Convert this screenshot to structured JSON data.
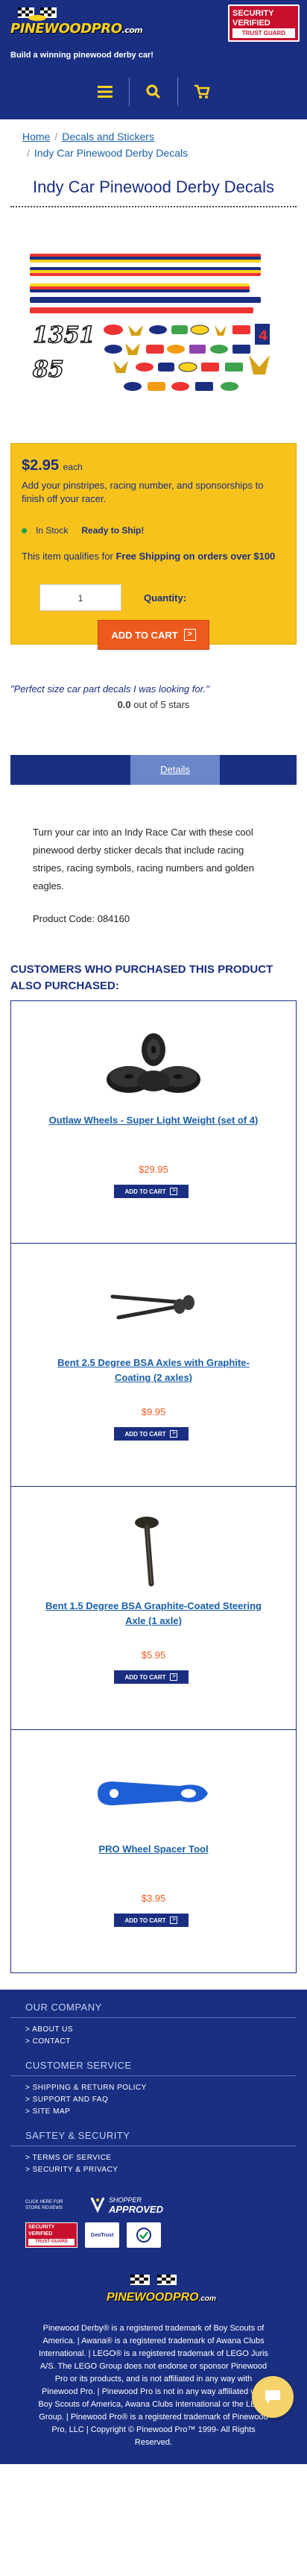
{
  "header": {
    "logo_text": "PINEWOODPRO",
    "logo_suffix": ".com",
    "tagline": "Build a winning pinewood derby car!",
    "security_badge": {
      "line1": "SECURITY",
      "line2": "VERIFIED",
      "line3": "TRUST GUARD"
    },
    "nav_icons": [
      "menu-icon",
      "search-icon",
      "cart-icon"
    ]
  },
  "breadcrumb": {
    "home": "Home",
    "separator": "/",
    "category": "Decals and Stickers",
    "current": "Indy Car Pinewood Derby Decals"
  },
  "product": {
    "title": "Indy Car Pinewood Derby Decals",
    "price": "$2.95",
    "price_unit": "each",
    "price_desc": "Add your pinstripes, racing number, and sponsorships to finish off your racer.",
    "stock_status": "In Stock",
    "stock_cta": "Ready to Ship!",
    "shipping_prefix": "This item qualifies for ",
    "shipping_bold": "Free Shipping on orders over $100",
    "quantity_value": "1",
    "quantity_label": "Quantity:",
    "add_to_cart_label": "ADD TO CART",
    "decal_numbers": [
      "1351",
      "85"
    ]
  },
  "review": {
    "quote": "\"Perfect size car part decals I was looking for.\"",
    "rating_value": "0.0",
    "rating_suffix": "out of 5 stars"
  },
  "tabs": {
    "active": "Details"
  },
  "details": {
    "description": "Turn your car into an Indy Race Car with these cool pinewood derby sticker decals that include racing stripes, racing symbols, racing numbers and golden eagles.",
    "product_code": "Product Code: 084160"
  },
  "also_purchased": {
    "title": "CUSTOMERS WHO PURCHASED THIS PRODUCT ALSO PURCHASED:",
    "button_label": "ADD TO CART",
    "items": [
      {
        "name": "Outlaw Wheels - Super Light Weight (set of 4)",
        "price": "$29.95"
      },
      {
        "name": "Bent 2.5 Degree BSA Axles with Graphite-Coating (2 axles)",
        "price": "$9.95"
      },
      {
        "name": "Bent 1.5 Degree BSA Graphite-Coated Steering Axle (1 axle)",
        "price": "$5.95"
      },
      {
        "name": "PRO Wheel Spacer Tool",
        "price": "$3.95"
      }
    ]
  },
  "footer": {
    "sections": [
      {
        "title": "OUR COMPANY",
        "links": [
          "> ABOUT US",
          "> CONTACT"
        ]
      },
      {
        "title": "CUSTOMER SERVICE",
        "links": [
          "> SHIPPING & RETURN POLICY",
          "> SUPPORT AND FAQ",
          "> SITE MAP"
        ]
      },
      {
        "title": "SAFTEY & SECURITY",
        "links": [
          "> TERMS OF SERVICE",
          "> SECURITY & PRIVACY"
        ]
      }
    ],
    "shopper_note": "CLICK HERE FOR STORE REVIEWS",
    "shopper_badge_top": "SHOPPER",
    "shopper_badge_bottom": "APPROVED",
    "geotrust_label": "GeoTrust",
    "logo_text": "PINEWOODPRO",
    "logo_suffix": ".com",
    "legal": "Pinewood Derby® is a registered trademark of Boy Scouts of America. | Awana® is a registered trademark of Awana Clubs International. | LEGO® is a registered trademark of LEGO Juris A/S. The LEGO Group does not endorse or sponsor Pinewood Pro or its products, and is not affiliated in any way with Pinewood Pro. | Pinewood Pro is not in any way affiliated with Boy Scouts of America, Awana Clubs International or the LEGO Group. | Pinewood Pro® is a registered trademark of Pinewood Pro, LLC | Copyright © Pinewood Pro™ 1999- All Rights Reserved."
  },
  "colors": {
    "brand_blue": "#1a2f82",
    "accent_yellow": "#f6c21b",
    "cta_orange": "#ee5a1e",
    "link_blue": "#1a5fa8",
    "stock_green": "#17a04a",
    "security_red": "#c8102e"
  }
}
